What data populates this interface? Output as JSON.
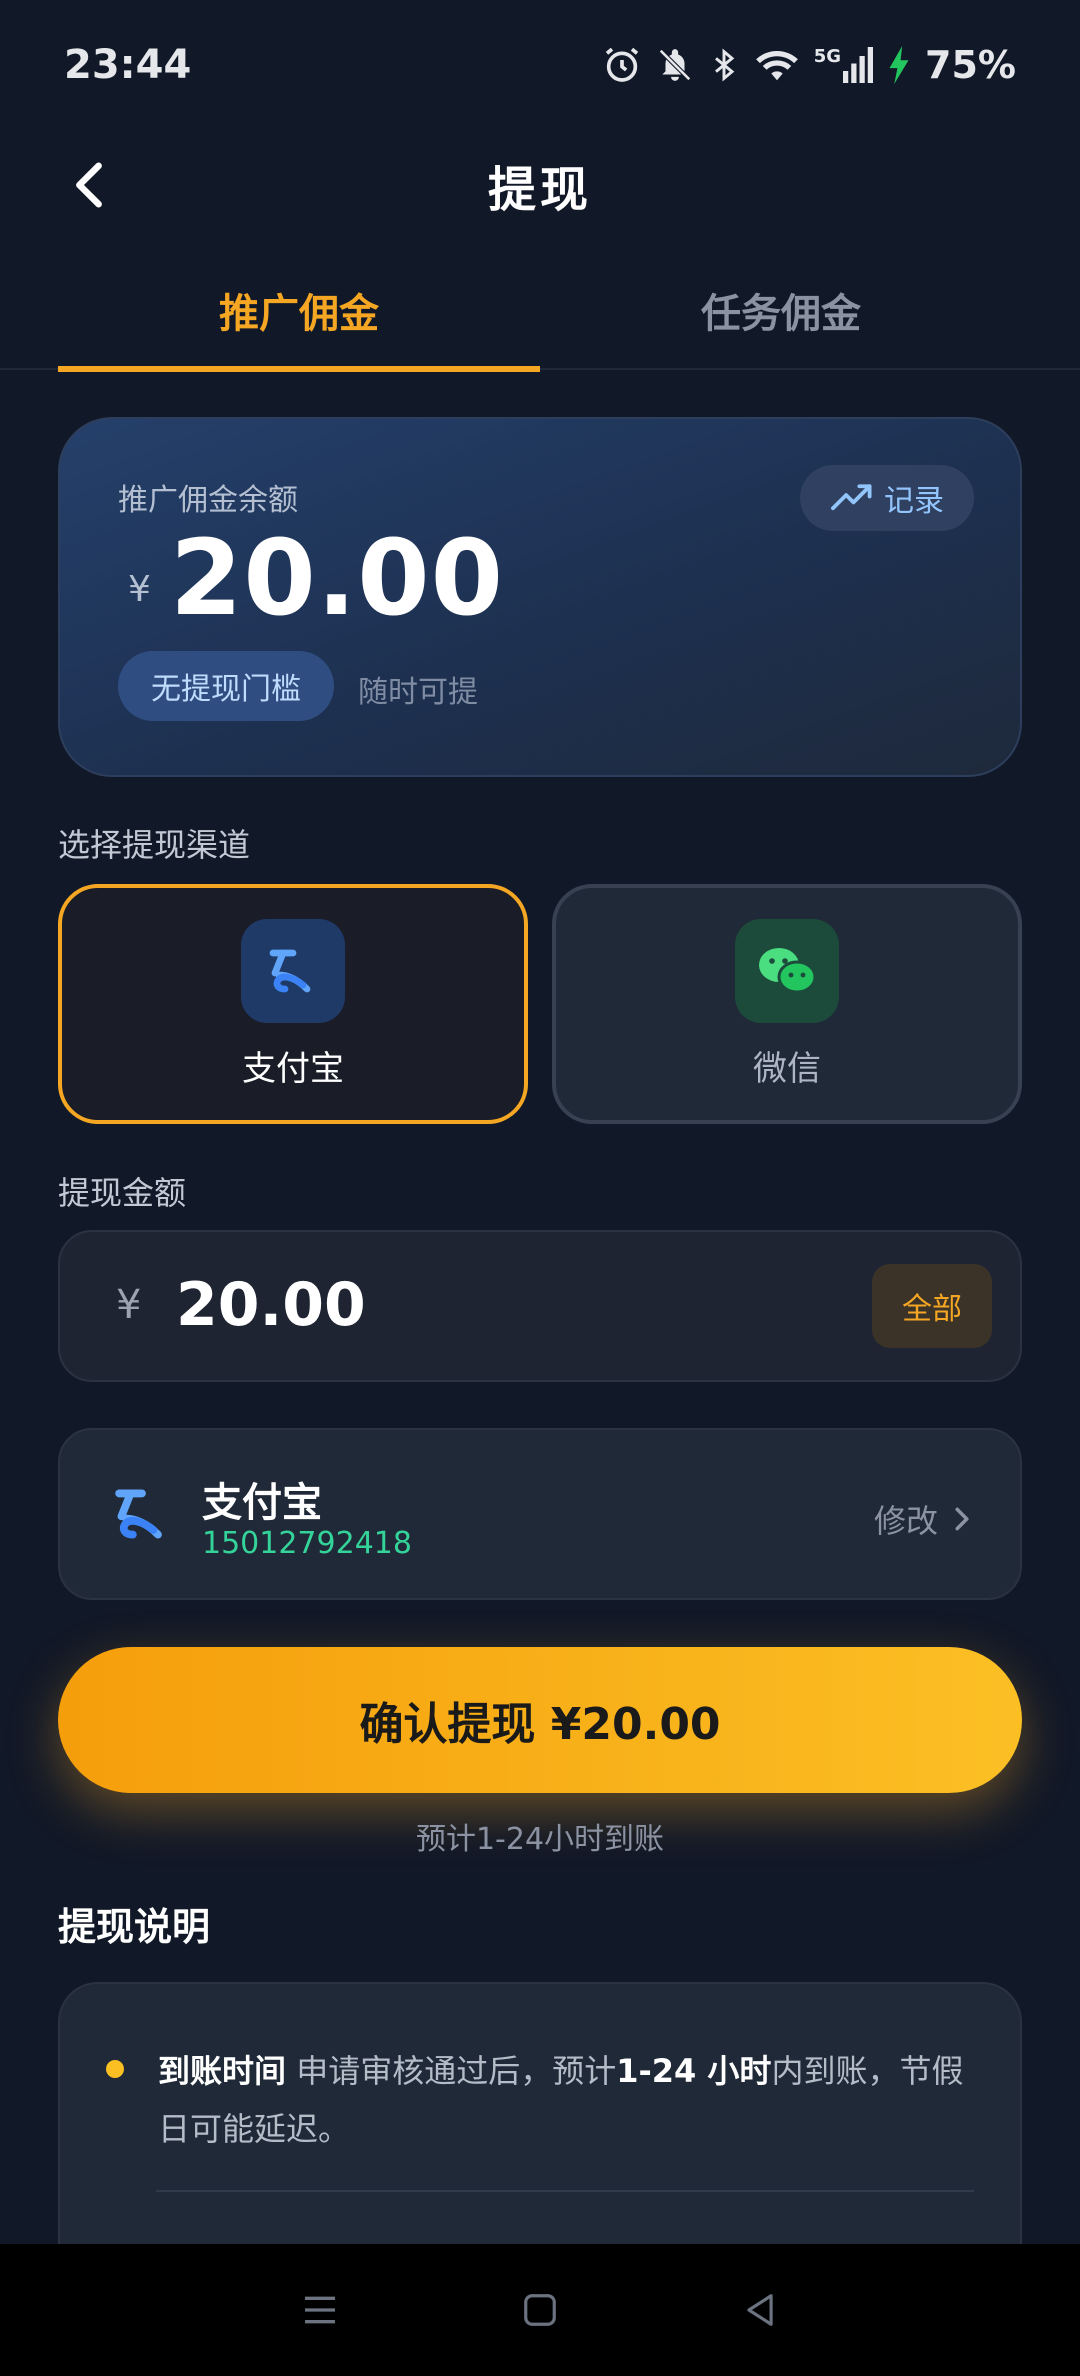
{
  "status_bar": {
    "time": "23:44",
    "battery": "75%",
    "network": "5G",
    "icons": [
      "alarm-icon",
      "bell-off-icon",
      "bluetooth-icon",
      "wifi-icon",
      "signal-icon",
      "charging-icon"
    ]
  },
  "header": {
    "title": "提现",
    "back_icon": "chevron-left-icon"
  },
  "tabs": [
    {
      "label": "推广佣金",
      "active": true
    },
    {
      "label": "任务佣金",
      "active": false
    }
  ],
  "balance_card": {
    "label": "推广佣金余额",
    "currency": "¥",
    "amount": "20.00",
    "record_label": "记录",
    "record_icon": "trending-up-icon",
    "tag": "无提现门槛",
    "tag_note": "随时可提"
  },
  "channel_section": {
    "label": "选择提现渠道",
    "channels": [
      {
        "name": "支付宝",
        "icon": "alipay-icon",
        "selected": true
      },
      {
        "name": "微信",
        "icon": "wechat-icon",
        "selected": false
      }
    ]
  },
  "amount_section": {
    "label": "提现金额",
    "currency": "¥",
    "value": "20.00",
    "all_label": "全部"
  },
  "account": {
    "name": "支付宝",
    "phone": "15012792418",
    "modify_label": "修改"
  },
  "confirm": {
    "label": "确认提现 ¥20.00",
    "note": "预计1-24小时到账"
  },
  "explanation": {
    "title": "提现说明",
    "items": [
      {
        "heading": "到账时间",
        "text_before": "申请审核通过后，预计",
        "highlight": "1-24 小时",
        "text_after": "内到账，节假日可能延迟。"
      }
    ]
  },
  "colors": {
    "accent": "#f5a623",
    "background": "#111827",
    "success": "#34d399",
    "link": "#93c5fd"
  }
}
